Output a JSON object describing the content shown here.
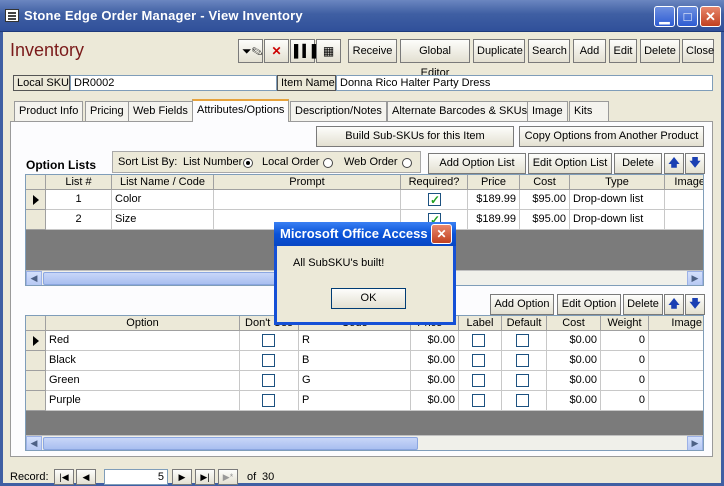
{
  "window": {
    "title": "Stone Edge Order Manager - View Inventory",
    "min": "▁",
    "max": "□",
    "close": "✕"
  },
  "heading": "Inventory",
  "toolbar": {
    "icons": [
      "funnel-pencil-icon",
      "funnel-x-icon",
      "barcode-icon",
      "grid-icon"
    ],
    "buttons": [
      "Receive",
      "Global Editor",
      "Duplicate",
      "Search",
      "Add",
      "Edit",
      "Delete",
      "Close"
    ]
  },
  "record": {
    "sku_label": "Local SKU",
    "sku_value": "DR0002",
    "name_label": "Item Name",
    "name_value": "Donna Rico Halter Party Dress"
  },
  "tabs": [
    "Product Info",
    "Pricing",
    "Web Fields",
    "Attributes/Options",
    "Description/Notes",
    "Alternate Barcodes & SKUs",
    "Image",
    "Kits"
  ],
  "actions": {
    "build": "Build Sub-SKUs for this Item",
    "copy": "Copy Options from Another Product"
  },
  "option_lists": {
    "title": "Option Lists",
    "sort_label": "Sort List By:",
    "sort_options": [
      "List Number",
      "Local Order",
      "Web Order"
    ],
    "buttons": [
      "Add Option List",
      "Edit Option List",
      "Delete"
    ],
    "columns": [
      "List #",
      "List Name / Code",
      "Prompt",
      "Required?",
      "Price",
      "Cost",
      "Type",
      "Image"
    ],
    "rows": [
      {
        "num": "1",
        "name": "Color",
        "prompt": "",
        "required": true,
        "price": "$189.99",
        "cost": "$95.00",
        "type": "Drop-down list"
      },
      {
        "num": "2",
        "name": "Size",
        "prompt": "",
        "required": true,
        "price": "$189.99",
        "cost": "$95.00",
        "type": "Drop-down list"
      }
    ]
  },
  "options": {
    "buttons": [
      "Add Option",
      "Edit Option",
      "Delete"
    ],
    "columns": [
      "Option",
      "Don't Use",
      "Code",
      "Price +",
      "Label",
      "Default",
      "Cost",
      "Weight",
      "Image"
    ],
    "rows": [
      {
        "option": "Red",
        "code": "R",
        "price": "$0.00",
        "cost": "$0.00",
        "weight": "0"
      },
      {
        "option": "Black",
        "code": "B",
        "price": "$0.00",
        "cost": "$0.00",
        "weight": "0"
      },
      {
        "option": "Green",
        "code": "G",
        "price": "$0.00",
        "cost": "$0.00",
        "weight": "0"
      },
      {
        "option": "Purple",
        "code": "P",
        "price": "$0.00",
        "cost": "$0.00",
        "weight": "0"
      }
    ]
  },
  "nav": {
    "label": "Record:",
    "current": "5",
    "of": "of",
    "total": "30"
  },
  "dialog": {
    "title": "Microsoft Office Access",
    "message": "All SubSKU's built!",
    "ok": "OK"
  },
  "colors": {
    "title_bar": "#3f5fa3",
    "heading": "#7a1a1a",
    "dialog_title": "#0a53d8",
    "tab_highlight": "#e6a23c"
  }
}
